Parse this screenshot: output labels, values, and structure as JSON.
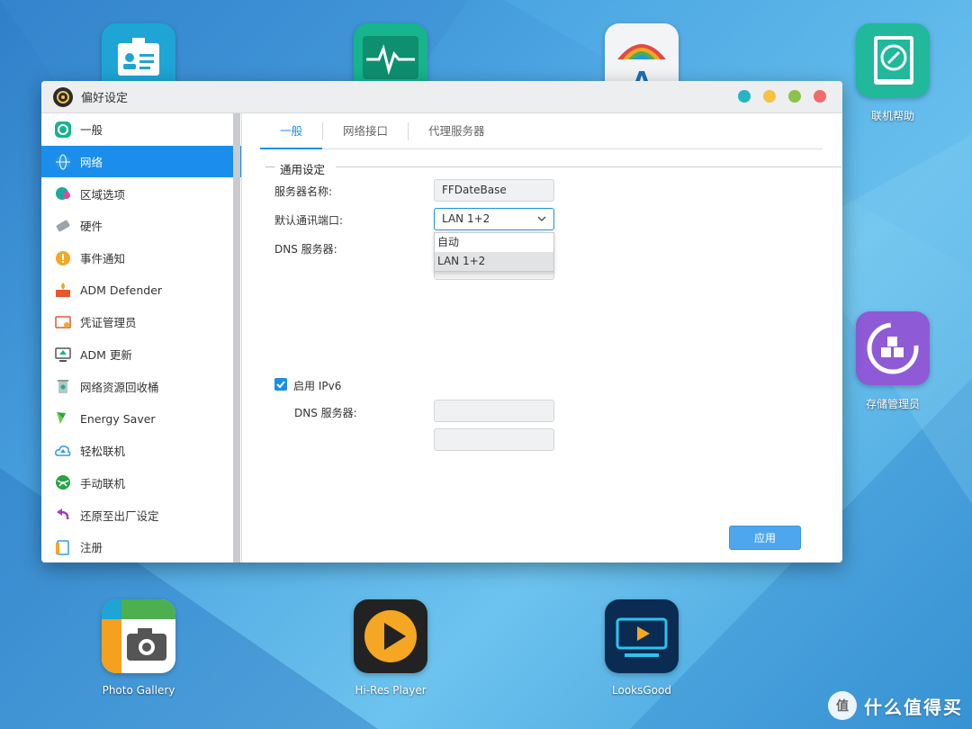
{
  "desktop": {
    "apps": [
      {
        "name": "",
        "icon": "id-card-icon"
      },
      {
        "name": "",
        "icon": "activity-monitor-icon"
      },
      {
        "name": "",
        "icon": "asustor-rainbow-icon"
      },
      {
        "name": "联机帮助",
        "icon": "compass-book-icon"
      },
      {
        "name": "存储管理员",
        "icon": "storage-manager-icon"
      },
      {
        "name": "Photo Gallery",
        "icon": "camera-icon"
      },
      {
        "name": "Hi-Res Player",
        "icon": "play-icon"
      },
      {
        "name": "LooksGood",
        "icon": "tv-play-icon"
      }
    ],
    "watermark": "什么值得买"
  },
  "window": {
    "title": "偏好设定",
    "controls": [
      {
        "name": "minimize",
        "color": "#27b4c4"
      },
      {
        "name": "maximize",
        "color": "#f5c242"
      },
      {
        "name": "fullscreen",
        "color": "#8bc34a"
      },
      {
        "name": "close",
        "color": "#f06b6b"
      }
    ]
  },
  "sidebar": {
    "items": [
      {
        "label": "一般",
        "icon": "general-icon"
      },
      {
        "label": "网络",
        "icon": "globe-icon",
        "active": true
      },
      {
        "label": "区域选项",
        "icon": "region-icon"
      },
      {
        "label": "硬件",
        "icon": "hardware-icon"
      },
      {
        "label": "事件通知",
        "icon": "alert-icon"
      },
      {
        "label": "ADM Defender",
        "icon": "firewall-icon"
      },
      {
        "label": "凭证管理员",
        "icon": "certificate-icon"
      },
      {
        "label": "ADM 更新",
        "icon": "update-icon"
      },
      {
        "label": "网络资源回收桶",
        "icon": "recycle-bin-icon"
      },
      {
        "label": "Energy Saver",
        "icon": "energy-icon"
      },
      {
        "label": "轻松联机",
        "icon": "cloud-upload-icon"
      },
      {
        "label": "手动联机",
        "icon": "manual-connect-icon"
      },
      {
        "label": "还原至出厂设定",
        "icon": "restore-icon"
      },
      {
        "label": "注册",
        "icon": "register-icon"
      }
    ]
  },
  "tabs": [
    {
      "label": "一般",
      "active": true
    },
    {
      "label": "网络接口"
    },
    {
      "label": "代理服务器"
    }
  ],
  "section": {
    "title": "通用设定",
    "server_name_label": "服务器名称:",
    "server_name_value": "FFDateBase",
    "default_port_label": "默认通讯端口:",
    "default_port_value": "LAN 1+2",
    "port_options": [
      "自动",
      "LAN 1+2"
    ],
    "dns_label": "DNS 服务器:",
    "ipv6_label": "启用 IPv6",
    "ipv6_checked": true,
    "ipv6_dns_label": "DNS 服务器:"
  },
  "apply_label": "应用"
}
